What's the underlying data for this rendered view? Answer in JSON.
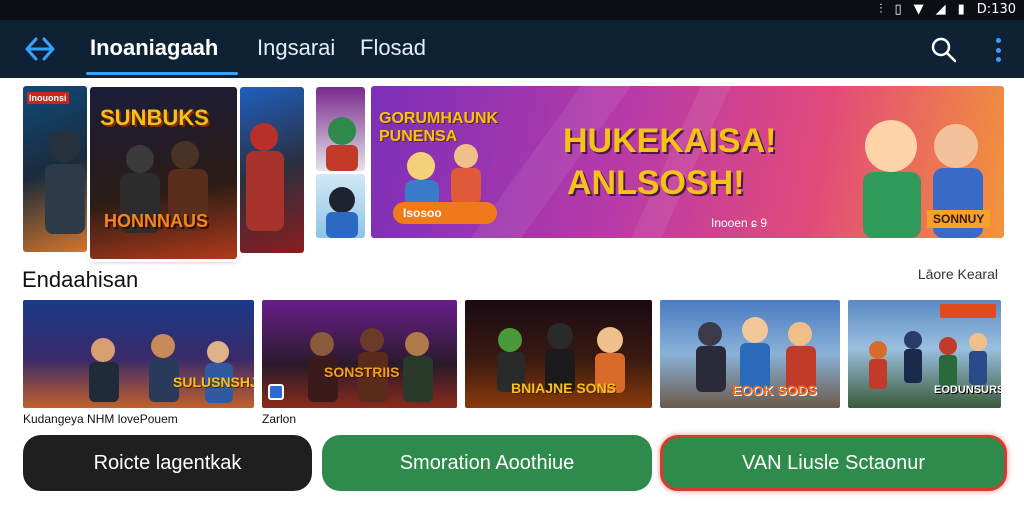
{
  "status_bar": {
    "time": "D:130",
    "icons": [
      "vibrate-icon",
      "notification-icon",
      "wifi-icon",
      "signal-icon",
      "battery-icon"
    ]
  },
  "app_bar": {
    "tabs": [
      {
        "label": "Inoaniagaah",
        "active": true
      },
      {
        "label": "Ingsarai",
        "active": false
      },
      {
        "label": "Flosad",
        "active": false
      }
    ],
    "accent": "#36a2ff",
    "background": "#0f2235"
  },
  "featured": {
    "small_tile_label": "Inouonsi",
    "main_tile_title": "SUNBUKS",
    "main_tile_subtitle": "HONNNAUS",
    "banner": {
      "logo_text": "GORUMHAUNK PUNENSA",
      "headline_line1": "HUKEKAISA!",
      "headline_line2": "ANLSOSH!",
      "pill_label": "Isosoo",
      "corner_text": "Inooen ɕ 9",
      "corner_badge": "SONNUY"
    }
  },
  "section": {
    "title": "Endaahisan",
    "more_label": "Lāore Kearal"
  },
  "thumbnails": [
    {
      "overlay": "SULUSNSHJANT",
      "caption": "Kudangeya NHM lovePouem"
    },
    {
      "overlay": "SONSTRIIS",
      "caption": "Zarlon"
    },
    {
      "overlay": "BNIAJNE SONS",
      "caption": ""
    },
    {
      "overlay": "EOOK SODS",
      "caption": ""
    },
    {
      "overlay": "EODUNSURS",
      "caption": ""
    }
  ],
  "buttons": [
    {
      "label": "Roicte lagentkak",
      "color": "#1f1f1f"
    },
    {
      "label": "Smoration Aoothiue",
      "color": "#2e8b4b"
    },
    {
      "label": "VAN Liusle Sctaonur",
      "color": "#2e8b4b",
      "border": "#d63a2f"
    }
  ]
}
